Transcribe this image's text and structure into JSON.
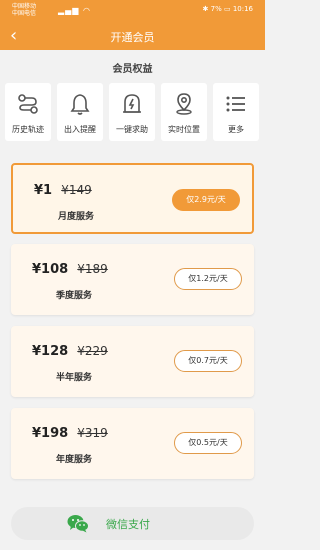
{
  "status_bar": {
    "carrier1": "中国移动",
    "carrier2": "中国电信",
    "battery": "7%",
    "time": "10:16"
  },
  "header": {
    "back_icon": "chevron-left-icon",
    "title": "开通会员"
  },
  "benefits": {
    "title": "会员权益",
    "items": [
      {
        "icon": "track-icon",
        "label": "历史轨迹"
      },
      {
        "icon": "bell-icon",
        "label": "出入提醒"
      },
      {
        "icon": "sos-icon",
        "label": "一键求助"
      },
      {
        "icon": "location-pin-icon",
        "label": "实时位置"
      },
      {
        "icon": "list-icon",
        "label": "更多"
      }
    ]
  },
  "plans": [
    {
      "price": "¥1",
      "original": "¥149",
      "name": "月度服务",
      "per_day": "仅2.9元/天",
      "selected": true
    },
    {
      "price": "¥108",
      "original": "¥189",
      "name": "季度服务",
      "per_day": "仅1.2元/天",
      "selected": false
    },
    {
      "price": "¥128",
      "original": "¥229",
      "name": "半年服务",
      "per_day": "仅0.7元/天",
      "selected": false
    },
    {
      "price": "¥198",
      "original": "¥319",
      "name": "年度服务",
      "per_day": "仅0.5元/天",
      "selected": false
    }
  ],
  "payment": {
    "icon": "wechat-icon",
    "label": "微信支付"
  },
  "colors": {
    "accent": "#f19a38",
    "wechat_green": "#3aa84b"
  }
}
